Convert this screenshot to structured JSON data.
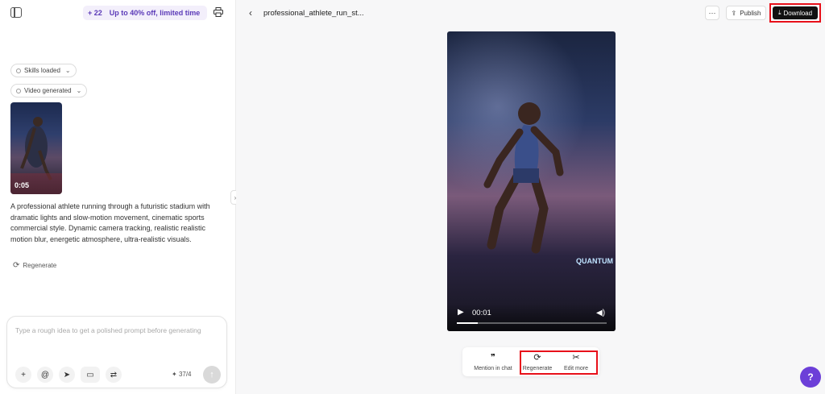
{
  "left_panel": {
    "promo": {
      "credits": "+ 22",
      "offer": "Up to 40% off, limited time"
    },
    "chips": [
      {
        "label": "Skills loaded"
      },
      {
        "label": "Video generated"
      }
    ],
    "thumbnail": {
      "time": "0:05"
    },
    "description": "A professional athlete running through a futuristic stadium with dramatic lights and slow-motion movement, cinematic sports commercial style. Dynamic camera tracking, realistic realistic motion blur, energetic atmosphere, ultra-realistic visuals.",
    "regenerate_label": "Regenerate",
    "composer": {
      "placeholder": "Type a rough idea to get a polished prompt before generating",
      "counter": "37/4"
    }
  },
  "right_panel": {
    "title": "professional_athlete_run_st...",
    "more_label": "···",
    "publish_label": "Publish",
    "download_label": "Download",
    "video": {
      "current_time": "00:01",
      "brand_text": "QUANTUM",
      "progress": 0.14
    },
    "actions": [
      {
        "label": "Mention in chat",
        "icon": "quote-icon"
      },
      {
        "label": "Regenerate",
        "icon": "refresh-icon"
      },
      {
        "label": "Edit more",
        "icon": "scissors-icon"
      }
    ]
  },
  "colors": {
    "accent": "#6c3fd8",
    "highlight": "#e8101a",
    "promo_text": "#5b3ab8"
  }
}
